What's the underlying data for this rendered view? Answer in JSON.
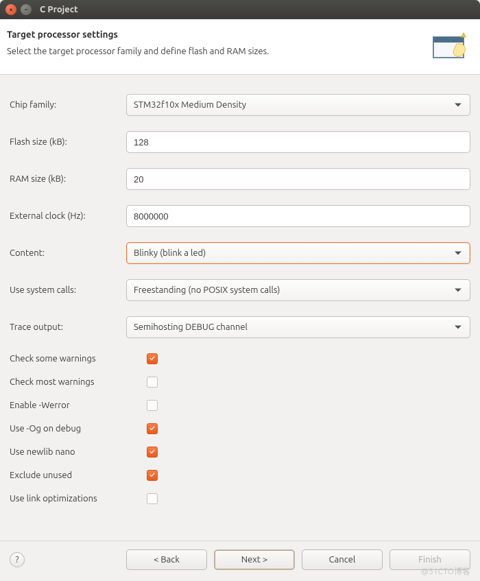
{
  "window": {
    "title": "C Project"
  },
  "header": {
    "title": "Target processor settings",
    "subtitle": "Select the target processor family and define flash and RAM sizes."
  },
  "fields": {
    "chip_family": {
      "label": "Chip family:",
      "value": "STM32f10x Medium Density"
    },
    "flash_size": {
      "label": "Flash size (kB):",
      "value": "128"
    },
    "ram_size": {
      "label": "RAM size (kB):",
      "value": "20"
    },
    "external_clock": {
      "label": "External clock (Hz):",
      "value": "8000000"
    },
    "content": {
      "label": "Content:",
      "value": "Blinky (blink a led)"
    },
    "system_calls": {
      "label": "Use system calls:",
      "value": "Freestanding (no POSIX system calls)"
    },
    "trace_output": {
      "label": "Trace output:",
      "value": "Semihosting DEBUG channel"
    }
  },
  "checks": {
    "check_some_warnings": {
      "label": "Check some warnings",
      "checked": true
    },
    "check_most_warnings": {
      "label": "Check most warnings",
      "checked": false
    },
    "enable_werror": {
      "label": "Enable -Werror",
      "checked": false
    },
    "use_og_debug": {
      "label": "Use -Og on debug",
      "checked": true
    },
    "use_newlib_nano": {
      "label": "Use newlib nano",
      "checked": true
    },
    "exclude_unused": {
      "label": "Exclude unused",
      "checked": true
    },
    "use_link_optimizations": {
      "label": "Use link optimizations",
      "checked": false
    }
  },
  "footer": {
    "back": "< Back",
    "next": "Next >",
    "cancel": "Cancel",
    "finish": "Finish"
  },
  "watermark": "@51CTO博客"
}
